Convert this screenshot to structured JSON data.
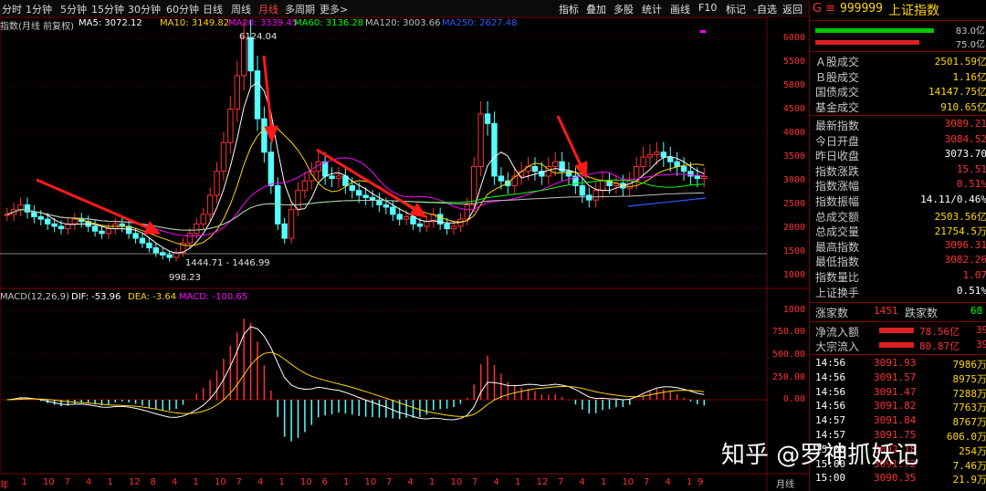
{
  "toolbar": {
    "periods": [
      "分时",
      "1分钟",
      "5分钟",
      "15分钟",
      "30分钟",
      "60分钟",
      "日线",
      "周线",
      "月线",
      "多周期",
      "更多>"
    ],
    "active_period": "月线",
    "right_items": [
      "指标",
      "叠加",
      "多股",
      "统计",
      "画线",
      "F10",
      "标记",
      "-自选",
      "返回"
    ]
  },
  "chart": {
    "title": "指数(月线 前复权)",
    "ma": [
      {
        "label": "MA5: 3072.12",
        "color": "#ffffff"
      },
      {
        "label": "MA10: 3149.82",
        "color": "#ffd700"
      },
      {
        "label": "MA20: 3339.45",
        "color": "#ff00ff"
      },
      {
        "label": "MA60: 3136.28",
        "color": "#00ff00"
      },
      {
        "label": "MA120: 3003.66",
        "color": "#c0c0c0"
      },
      {
        "label": "MA250: 2627.48",
        "color": "#2b5bff"
      }
    ],
    "price_axis": [
      "6000",
      "5500",
      "5000",
      "4500",
      "4000",
      "3500",
      "3000",
      "2500",
      "2000",
      "1500",
      "1000"
    ],
    "annotations": {
      "high": "6124.04",
      "low": "998.23",
      "range": "1444.71 - 1446.99"
    },
    "macd_legend": [
      {
        "label": "MACD(12,26,9)",
        "color": "#c8c8c8"
      },
      {
        "label": "DIF: -53.96",
        "color": "#ffffff"
      },
      {
        "label": "DEA: -3.64",
        "color": "#ffd700"
      },
      {
        "label": "MACD: -100.65",
        "color": "#ff00ff"
      }
    ],
    "macd_axis": [
      "1000",
      "750.00",
      "500.00",
      "250.00",
      "0.00"
    ],
    "x_axis": [
      "年",
      "1",
      "10",
      "7",
      "4",
      "1",
      "12",
      "8",
      "4",
      "1",
      "10",
      "7",
      "4",
      "1",
      "10",
      "6",
      "1",
      "10",
      "7",
      "4",
      "1",
      "10",
      "7",
      "4",
      "1",
      "12",
      "7",
      "4",
      "1",
      "10",
      "7",
      "4",
      "1",
      "9"
    ],
    "period_tag": "月线"
  },
  "panel": {
    "code": "999999",
    "name": "上证指数",
    "bar1": "83.0亿",
    "bar2": "75.0亿",
    "volumes": [
      {
        "k": "Ａ股成交",
        "v": "2501.59亿"
      },
      {
        "k": "Ｂ股成交",
        "v": "1.16亿"
      },
      {
        "k": "国债成交",
        "v": "14147.75亿"
      },
      {
        "k": "基金成交",
        "v": "910.65亿"
      }
    ],
    "stats": [
      {
        "k": "最新指数",
        "v": "3089.21",
        "c": "red"
      },
      {
        "k": "今日开盘",
        "v": "3084.52",
        "c": "red"
      },
      {
        "k": "昨日收盘",
        "v": "3073.70",
        "c": "white"
      },
      {
        "k": "指数涨跌",
        "v": "15.51",
        "c": "red"
      },
      {
        "k": "指数涨幅",
        "v": "0.51%",
        "c": "red"
      },
      {
        "k": "指数振幅",
        "v": "14.11/0.46%",
        "c": "white"
      },
      {
        "k": "总成交额",
        "v": "2503.56亿",
        "c": "yel"
      },
      {
        "k": "总成交量",
        "v": "21754.5万",
        "c": "yel"
      },
      {
        "k": "最高指数",
        "v": "3096.31",
        "c": "red"
      },
      {
        "k": "最低指数",
        "v": "3082.26",
        "c": "red"
      },
      {
        "k": "指数量比",
        "v": "1.07",
        "c": "red"
      },
      {
        "k": "上证换手",
        "v": "0.51%",
        "c": "white"
      }
    ],
    "up_label": "涨家数",
    "up_value": "1451",
    "down_label": "跌家数",
    "down_value": "68",
    "flows": [
      {
        "k": "净流入额",
        "v": "78.56亿",
        "tail": "39"
      },
      {
        "k": "大宗流入",
        "v": "80.87亿",
        "tail": "39"
      }
    ],
    "ticks": [
      {
        "t": "14:56",
        "p": "3091.93",
        "v": "7986万"
      },
      {
        "t": "14:56",
        "p": "3091.57",
        "v": "8975万"
      },
      {
        "t": "14:56",
        "p": "3091.47",
        "v": "7288万"
      },
      {
        "t": "14:56",
        "p": "3091.82",
        "v": "7763万"
      },
      {
        "t": "14:57",
        "p": "3091.84",
        "v": "8767万"
      },
      {
        "t": "14:57",
        "p": "3091.75",
        "v": "606.0万"
      },
      {
        "t": "15:00",
        "p": "3092.18",
        "v": "254万"
      },
      {
        "t": "15:00",
        "p": "3091.72",
        "v": "7.46万"
      },
      {
        "t": "15:00",
        "p": "3090.35",
        "v": "21.9万"
      }
    ]
  },
  "watermark": "知乎 @罗神抓妖记"
}
